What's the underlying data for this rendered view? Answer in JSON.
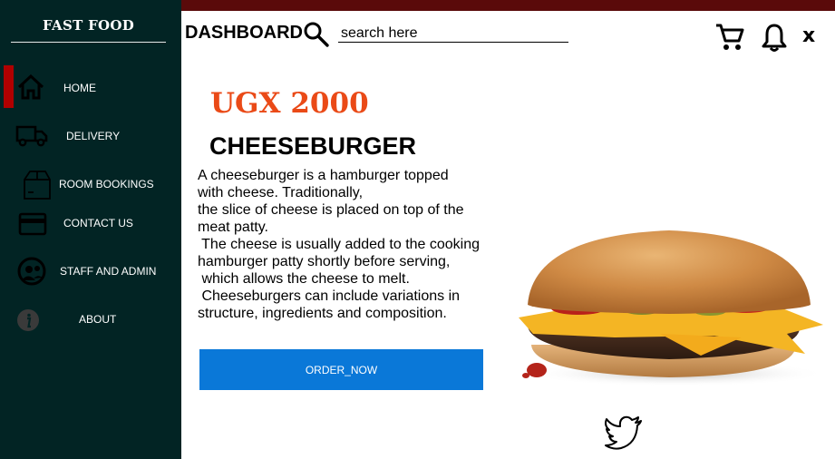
{
  "sidebar": {
    "brand": "FAST  FOOD",
    "items": [
      {
        "label": "HOME",
        "icon": "home-icon"
      },
      {
        "label": "DELIVERY",
        "icon": "truck-icon"
      },
      {
        "label": "ROOM BOOKINGS",
        "icon": "package-icon"
      },
      {
        "label": "CONTACT US",
        "icon": "credit-card-icon"
      },
      {
        "label": "STAFF AND ADMIN",
        "icon": "staff-icon"
      },
      {
        "label": "ABOUT",
        "icon": "info-icon"
      }
    ],
    "active_item": "HOME"
  },
  "header": {
    "title": "DASHBOARD",
    "search_placeholder": "search here",
    "icons": [
      "search-icon",
      "cart-icon",
      "bell-icon",
      "close-icon"
    ],
    "close_label": "x"
  },
  "product": {
    "price": "UGX 2000",
    "name": "CHEESEBURGER",
    "description_lines": [
      "A cheeseburger is a hamburger topped",
      "with cheese. Traditionally,",
      "the slice of cheese is placed on top of the",
      "meat patty.",
      " The cheese is usually added to the cooking",
      "hamburger patty shortly before serving,",
      " which allows the cheese to melt.",
      " Cheeseburgers can include variations in",
      "structure, ingredients and composition."
    ],
    "order_button": "ORDER_NOW",
    "image": "cheeseburger-image"
  },
  "footer": {
    "icons": [
      "twitter-icon"
    ]
  },
  "colors": {
    "sidebar_bg": "#022424",
    "top_strip": "#5a0a0a",
    "active_indicator": "#b00000",
    "price": "#ea4a17",
    "order_button": "#0a78d8"
  }
}
